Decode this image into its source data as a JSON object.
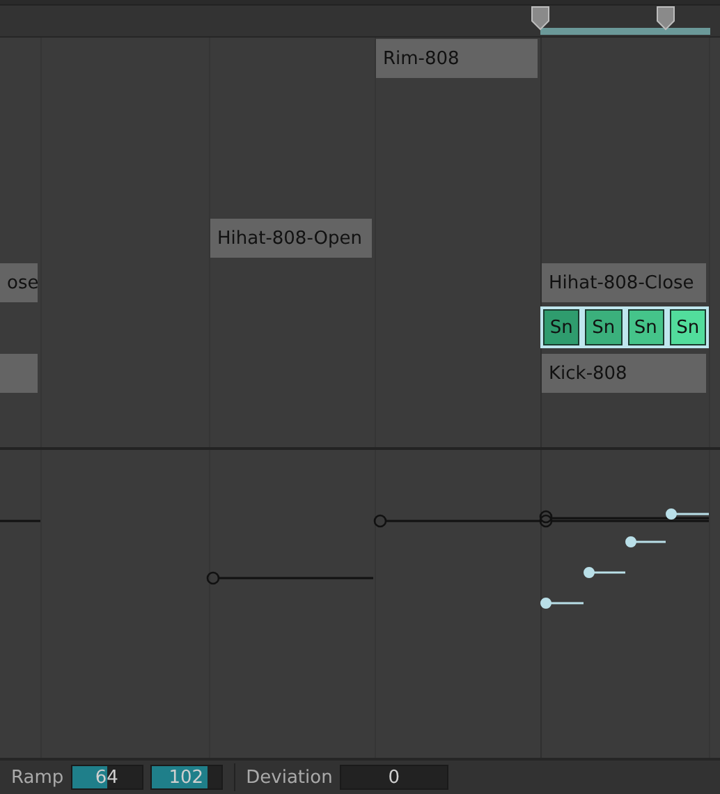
{
  "notes": [
    {
      "label": "Rim-808",
      "selected": false
    },
    {
      "label": "Hihat-808-Open",
      "selected": false
    },
    {
      "label": "ose",
      "selected": false
    },
    {
      "label": "Hihat-808-Close",
      "selected": false
    },
    {
      "selected": false
    },
    {
      "label": "Kick-808",
      "selected": false
    }
  ],
  "selected_notes": [
    {
      "label": "Sn",
      "color": "#2f9c6e"
    },
    {
      "label": "Sn",
      "color": "#3bb07c"
    },
    {
      "label": "Sn",
      "color": "#45c48a"
    },
    {
      "label": "Sn",
      "color": "#52dd9c"
    }
  ],
  "bottom_bar": {
    "ramp_label": "Ramp",
    "ramp_fields": [
      {
        "value": "64",
        "level": 0.5
      },
      {
        "value": "102",
        "level": 0.8
      }
    ],
    "deviation_label": "Deviation",
    "deviation_value": "0"
  }
}
